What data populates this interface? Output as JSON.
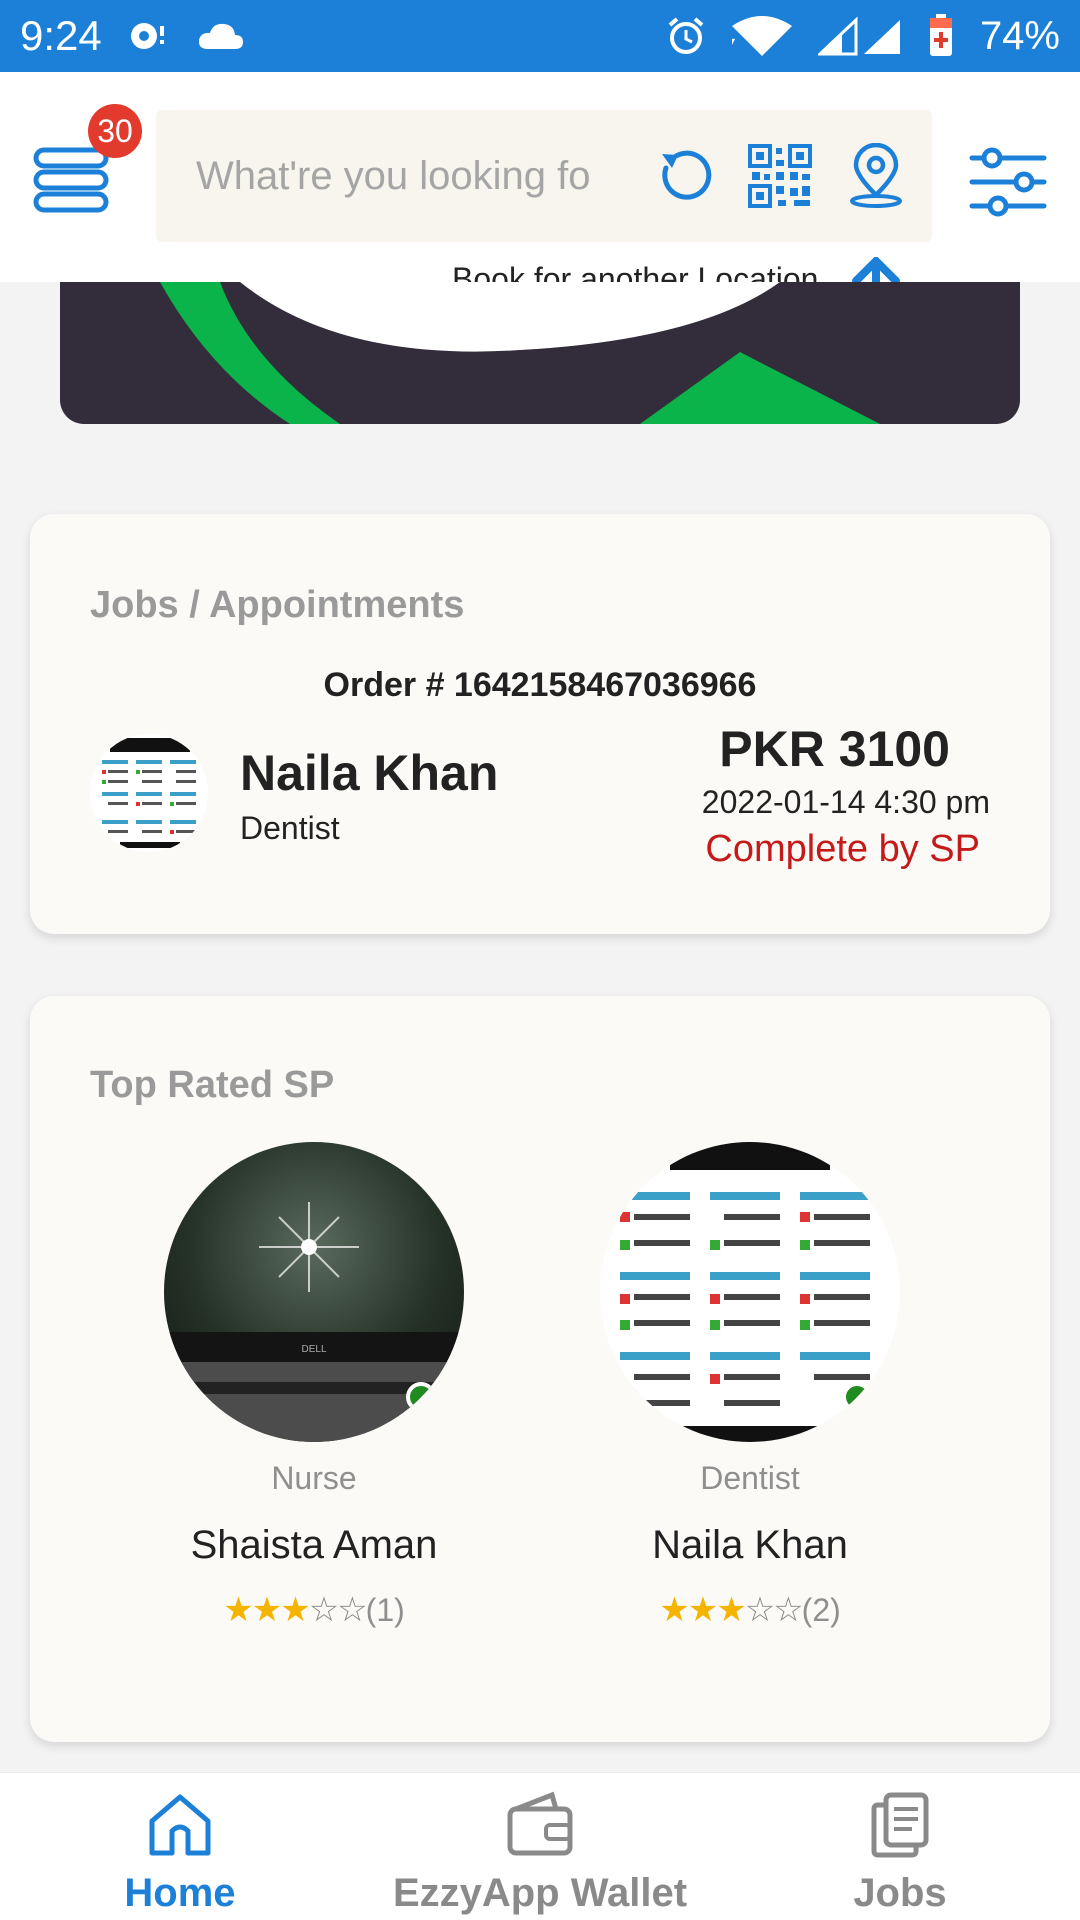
{
  "status_bar": {
    "time": "9:24",
    "battery": "74%"
  },
  "header": {
    "menu_badge": "30",
    "search_placeholder": "What're you looking fo",
    "book_text": "Book for another Location"
  },
  "jobs": {
    "title": "Jobs / Appointments",
    "order_no": "Order # 1642158467036966",
    "name": "Naila Khan",
    "role": "Dentist",
    "price": "PKR 3100",
    "datetime": "2022-01-14 4:30 pm",
    "status": "Complete by SP"
  },
  "top_rated": {
    "title": "Top Rated SP",
    "providers": [
      {
        "role": "Nurse",
        "name": "Shaista Aman",
        "rating_stars": 3,
        "reviews": "(1)"
      },
      {
        "role": "Dentist",
        "name": "Naila Khan",
        "rating_stars": 3,
        "reviews": "(2)"
      }
    ]
  },
  "bottom_nav": {
    "items": [
      {
        "label": "Home",
        "active": true
      },
      {
        "label": "EzzyApp Wallet",
        "active": false
      },
      {
        "label": "Jobs",
        "active": false
      }
    ]
  },
  "colors": {
    "status_bar": "#1c80d9",
    "accent": "#1c80d9",
    "complete_status": "#c51a1a",
    "star": "#f5b400",
    "online_dot": "#1f8a1f"
  }
}
